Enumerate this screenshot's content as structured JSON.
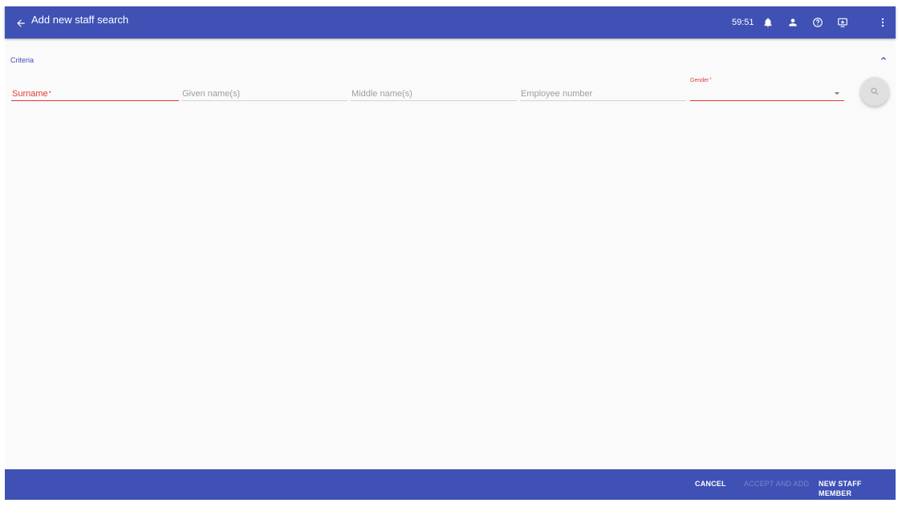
{
  "header": {
    "title": "Add new staff search",
    "timer": "59:51",
    "icons": [
      "arrow-back-icon",
      "bell-icon",
      "person-icon",
      "help-icon",
      "screen-share-icon",
      "more-vert-icon"
    ]
  },
  "criteria": {
    "label": "Criteria",
    "fields": {
      "surname": {
        "label": "Surname",
        "required": "*"
      },
      "given": {
        "label": "Given name(s)"
      },
      "middle": {
        "label": "Middle name(s)"
      },
      "employee": {
        "label": "Employee number"
      },
      "gender": {
        "label": "Gender",
        "required": "*",
        "value": ""
      }
    }
  },
  "footer": {
    "cancel": "CANCEL",
    "accept": "ACCEPT AND ADD",
    "new_staff": "NEW STAFF MEMBER"
  },
  "colors": {
    "primary": "#3f51b5",
    "error": "#e53935",
    "background": "#fafafa"
  }
}
